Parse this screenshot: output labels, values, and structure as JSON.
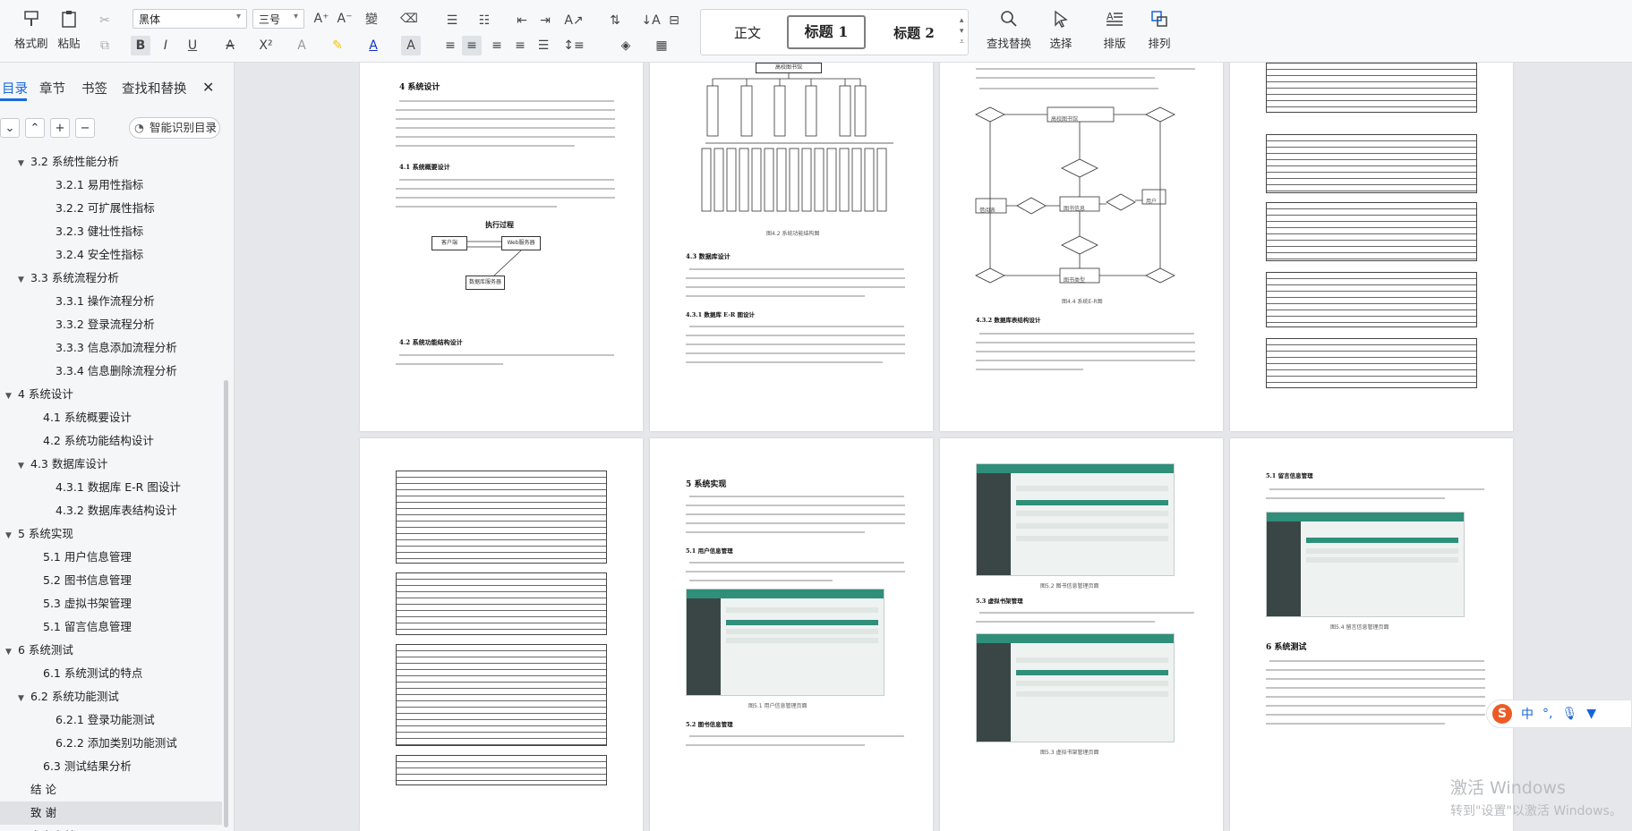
{
  "ribbon": {
    "format_painter": "格式刷",
    "paste": "粘贴",
    "font_name": "黑体",
    "font_size": "三号",
    "styles": {
      "normal": "正文",
      "heading1": "标题 1",
      "heading2": "标题 2"
    },
    "find_replace": "查找替换",
    "select": "选择",
    "layout": "排版",
    "arrange": "排列"
  },
  "panel": {
    "tabs": [
      "目录",
      "章节",
      "书签",
      "查找和替换"
    ],
    "smart_btn": "智能识别目录",
    "toc": [
      {
        "label": "3.2 系统性能分析",
        "level": 1,
        "caret": "▼"
      },
      {
        "label": "3.2.1 易用性指标",
        "level": 2,
        "caret": ""
      },
      {
        "label": "3.2.2 可扩展性指标",
        "level": 2,
        "caret": ""
      },
      {
        "label": "3.2.3 健壮性指标",
        "level": 2,
        "caret": ""
      },
      {
        "label": "3.2.4 安全性指标",
        "level": 2,
        "caret": ""
      },
      {
        "label": "3.3 系统流程分析",
        "level": 1,
        "caret": "▼"
      },
      {
        "label": "3.3.1 操作流程分析",
        "level": 2,
        "caret": ""
      },
      {
        "label": "3.3.2 登录流程分析",
        "level": 2,
        "caret": ""
      },
      {
        "label": "3.3.3 信息添加流程分析",
        "level": 2,
        "caret": ""
      },
      {
        "label": "3.3.4 信息删除流程分析",
        "level": 2,
        "caret": ""
      },
      {
        "label": "4 系统设计",
        "level": 0,
        "caret": "▼"
      },
      {
        "label": "4.1 系统概要设计",
        "level": 1,
        "caret": ""
      },
      {
        "label": "4.2 系统功能结构设计",
        "level": 1,
        "caret": ""
      },
      {
        "label": "4.3 数据库设计",
        "level": 1,
        "caret": "▼"
      },
      {
        "label": "4.3.1 数据库 E-R 图设计",
        "level": 2,
        "caret": ""
      },
      {
        "label": "4.3.2 数据库表结构设计",
        "level": 2,
        "caret": ""
      },
      {
        "label": "5 系统实现",
        "level": 0,
        "caret": "▼"
      },
      {
        "label": "5.1 用户信息管理",
        "level": 1,
        "caret": ""
      },
      {
        "label": "5.2 图书信息管理",
        "level": 1,
        "caret": ""
      },
      {
        "label": "5.3 虚拟书架管理",
        "level": 1,
        "caret": ""
      },
      {
        "label": "5.1 留言信息管理",
        "level": 1,
        "caret": ""
      },
      {
        "label": "6 系统测试",
        "level": 0,
        "caret": "▼"
      },
      {
        "label": "6.1 系统测试的特点",
        "level": 1,
        "caret": ""
      },
      {
        "label": "6.2 系统功能测试",
        "level": 1,
        "caret": "▼"
      },
      {
        "label": "6.2.1 登录功能测试",
        "level": 2,
        "caret": ""
      },
      {
        "label": "6.2.2 添加类别功能测试",
        "level": 2,
        "caret": ""
      },
      {
        "label": "6.3 测试结果分析",
        "level": 1,
        "caret": ""
      },
      {
        "label": "结 论",
        "level": 0,
        "caret": ""
      },
      {
        "label": "致 谢",
        "level": 0,
        "caret": "",
        "selected": true
      },
      {
        "label": "参考文献",
        "level": 0,
        "caret": ""
      }
    ]
  },
  "pages": {
    "p1": {
      "h1": "4 系统设计",
      "h2a": "4.1 系统概要设计",
      "flow_title": "执行过程",
      "flow_nodes": [
        "客户端",
        "Web服务器",
        "数据库服务器"
      ],
      "h2b": "4.2 系统功能结构设计"
    },
    "p2": {
      "top_box": "高校图书馆",
      "cap": "图4.2 系统功能结构图",
      "h2": "4.3 数据库设计",
      "h3": "4.3.1 数据库 E-R 图设计"
    },
    "p3": {
      "cap": "图4.4 系统E-R图",
      "h3": "4.3.2 数据库表结构设计",
      "nodes": [
        "高校图书馆",
        "图书信息",
        "借阅表",
        "图书类型",
        "用户"
      ]
    },
    "p6": {
      "h1": "5 系统实现",
      "h2a": "5.1 用户信息管理",
      "cap": "图5.1 用户信息管理页面",
      "h2b": "5.2 图书信息管理"
    },
    "p7": {
      "cap1": "图5.2 图书信息管理页面",
      "h2": "5.3 虚拟书架管理",
      "cap2": "图5.3 虚拟书架管理页面"
    },
    "p8": {
      "h2": "5.1 留言信息管理",
      "cap": "图5.4 留言信息管理页面",
      "h1": "6 系统测试"
    }
  },
  "watermark": {
    "line1": "激活 Windows",
    "line2": "转到\"设置\"以激活 Windows。"
  },
  "ime": {
    "lang": "中"
  }
}
